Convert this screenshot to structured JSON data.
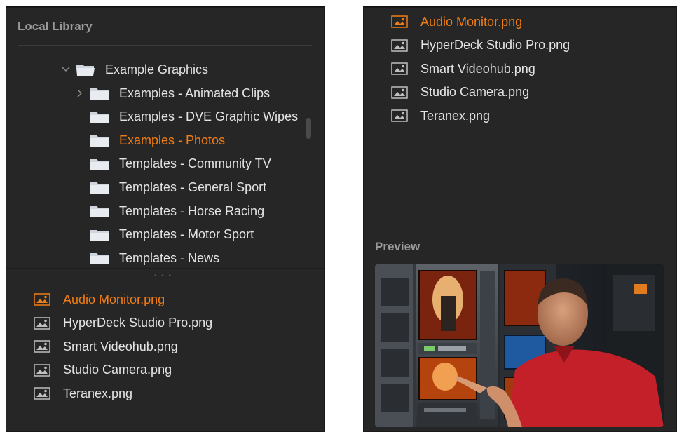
{
  "left": {
    "title": "Local Library",
    "tree": {
      "root": "Example Graphics",
      "children": [
        "Examples - Animated Clips",
        "Examples - DVE Graphic Wipes",
        "Examples - Photos",
        "Templates - Community TV",
        "Templates - General Sport",
        "Templates - Horse Racing",
        "Templates - Motor Sport",
        "Templates - News"
      ],
      "selected": "Examples - Photos"
    },
    "files": [
      "Audio Monitor.png",
      "HyperDeck Studio Pro.png",
      "Smart Videohub.png",
      "Studio Camera.png",
      "Teranex.png"
    ],
    "selected_file": "Audio Monitor.png",
    "splitter": "• • •"
  },
  "right": {
    "files": [
      "Audio Monitor.png",
      "HyperDeck Studio Pro.png",
      "Smart Videohub.png",
      "Studio Camera.png",
      "Teranex.png"
    ],
    "selected_file": "Audio Monitor.png",
    "preview_title": "Preview",
    "preview_image": "person-pointing-at-broadcast-monitor-wall"
  },
  "colors": {
    "panel_bg": "#262626",
    "text": "#e4e4e4",
    "accent": "#f07d16",
    "section_title": "#9a9a9a"
  },
  "icons": {
    "folder": "folder-icon",
    "open_folder": "folder-open-icon",
    "image_file": "image-file-icon",
    "chevron_down": "chevron-down-icon",
    "chevron_right": "chevron-right-icon"
  }
}
